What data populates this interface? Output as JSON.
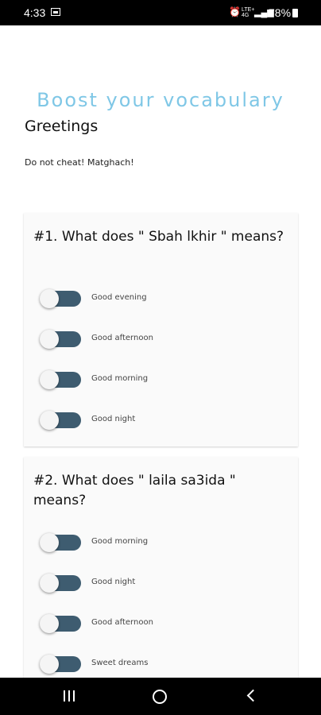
{
  "status_bar": {
    "time": "4:33",
    "network": "LTE+ ",
    "network_sub": "4G",
    "battery": "78%",
    "icons": [
      "gallery-icon",
      "alarm-icon",
      "signal-icon",
      "battery-icon"
    ]
  },
  "header": {
    "app_title": "Boost your vocabulary",
    "lesson_title": "Greetings",
    "subtitle": "Do not cheat! Matghach!"
  },
  "questions": [
    {
      "text": "#1. What does \" Sbah lkhir \" means?",
      "options": [
        {
          "label": "Good evening",
          "checked": false
        },
        {
          "label": "Good afternoon",
          "checked": false
        },
        {
          "label": "Good morning",
          "checked": false
        },
        {
          "label": "Good night",
          "checked": false
        }
      ]
    },
    {
      "text": "#2. What does \" laila sa3ida \" means?",
      "options": [
        {
          "label": "Good morning",
          "checked": false
        },
        {
          "label": "Good night",
          "checked": false
        },
        {
          "label": "Good afternoon",
          "checked": false
        },
        {
          "label": "Sweet dreams",
          "checked": false
        }
      ]
    }
  ],
  "colors": {
    "accent": "#7fc7e6",
    "toggle_track": "#3e5c70",
    "toggle_thumb": "#f5f5f5",
    "card_background": "#fafafa"
  },
  "nav_bar": {
    "icons": [
      "recent-apps-icon",
      "home-icon",
      "back-icon"
    ]
  }
}
